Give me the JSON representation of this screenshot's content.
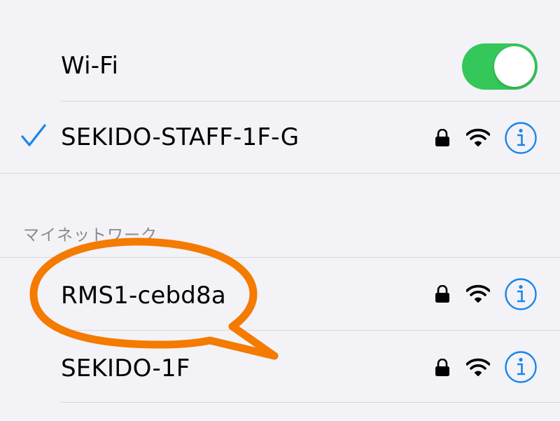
{
  "wifi": {
    "title": "Wi-Fi",
    "enabled": true,
    "toggle_color": "#34c759"
  },
  "connected": {
    "name": "SEKIDO-STAFF-1F-G",
    "icons": [
      "checkmark-icon",
      "lock-icon",
      "wifi-signal-icon",
      "info-icon"
    ]
  },
  "my_networks": {
    "header": "マイネットワーク",
    "items": [
      {
        "name": "RMS1-cebd8a",
        "secured": true
      },
      {
        "name": "SEKIDO-1F",
        "secured": true
      }
    ]
  },
  "annotation": {
    "type": "speech-bubble",
    "color": "#f47a00",
    "highlights": "RMS1-cebd8a"
  },
  "colors": {
    "accent": "#1a86e8",
    "background": "#f2f2f7",
    "separator": "#d7d7dc"
  }
}
